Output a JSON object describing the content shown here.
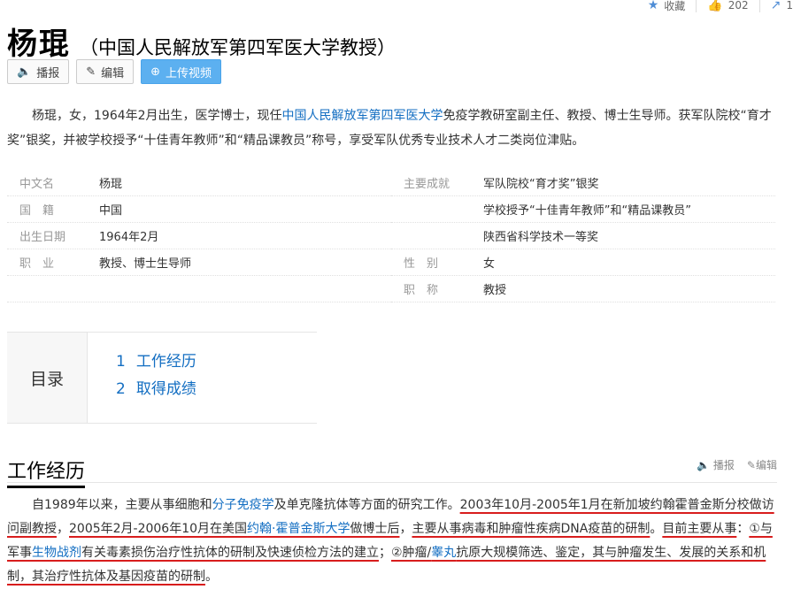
{
  "topbar": {
    "favorite_label": "收藏",
    "likes": "202",
    "share_count": "1"
  },
  "title": {
    "name": "杨琨",
    "subtitle": "（中国人民解放军第四军医大学教授）"
  },
  "buttons": {
    "play": "播报",
    "edit": "编辑",
    "upload": "上传视频"
  },
  "summary": {
    "p1": "杨琨，女，1964年2月出生，医学博士，现任",
    "link": "中国人民解放军第四军医大学",
    "p2": "免疫学教研室副主任、教授、博士生导师。获军队院校“育才奖”银奖，并被学校授予“十佳青年教师”和“精品课教员”称号，享受军队优秀专业技术人才二类岗位津贴。"
  },
  "infobox": {
    "left": [
      {
        "k": "中文名",
        "v": "杨琨"
      },
      {
        "k": "国　籍",
        "v": "中国",
        "link": true
      },
      {
        "k": "出生日期",
        "v": "1964年2月"
      },
      {
        "k": "职　业",
        "v": "教授、博士生导师"
      }
    ],
    "right": [
      {
        "k": "主要成就",
        "v": "军队院校“育才奖”银奖"
      },
      {
        "k": "",
        "v": "学校授予“十佳青年教师”和“精品课教员”"
      },
      {
        "k": "",
        "v": "陕西省科学技术一等奖"
      },
      {
        "k": "性　别",
        "v": "女"
      },
      {
        "k": "职　称",
        "v": "教授"
      }
    ]
  },
  "toc": {
    "label": "目录",
    "items": [
      {
        "num": "1",
        "label": "工作经历"
      },
      {
        "num": "2",
        "label": "取得成绩"
      }
    ]
  },
  "section": {
    "title": "工作经历",
    "play": "播报",
    "edit": "编辑",
    "t1": "自1989年以来，主要从事细胞和",
    "l1": "分子免疫学",
    "t2": "及单克隆抗体等方面的研究工作。",
    "t3": "2003年10月-2005年1月在新加坡约翰霍普金斯分校做访问副教授",
    "t4": "，",
    "t5": "2005年2月-2006年10月在美国",
    "l2": "约翰·霍普金斯大学",
    "t6": "做博士后",
    "t7": "，",
    "t8": "主要从事病毒和肿瘤性疾病DNA疫苗的研制",
    "t9": "。",
    "t10": "目前主要从事",
    "t11": "：",
    "t12": "①与军事",
    "l3": "生物战剂",
    "t13": "有关毒素损伤治疗性抗体的研制及快速侦检方法的建立",
    "t14": "；",
    "t15": "②肿瘤/",
    "l4": "睾丸",
    "t16": "抗原大规模筛选、鉴定，其与肿瘤发生、发展的关系和机制，其治疗性抗体及基因疫苗的研制",
    "t17": "。"
  }
}
